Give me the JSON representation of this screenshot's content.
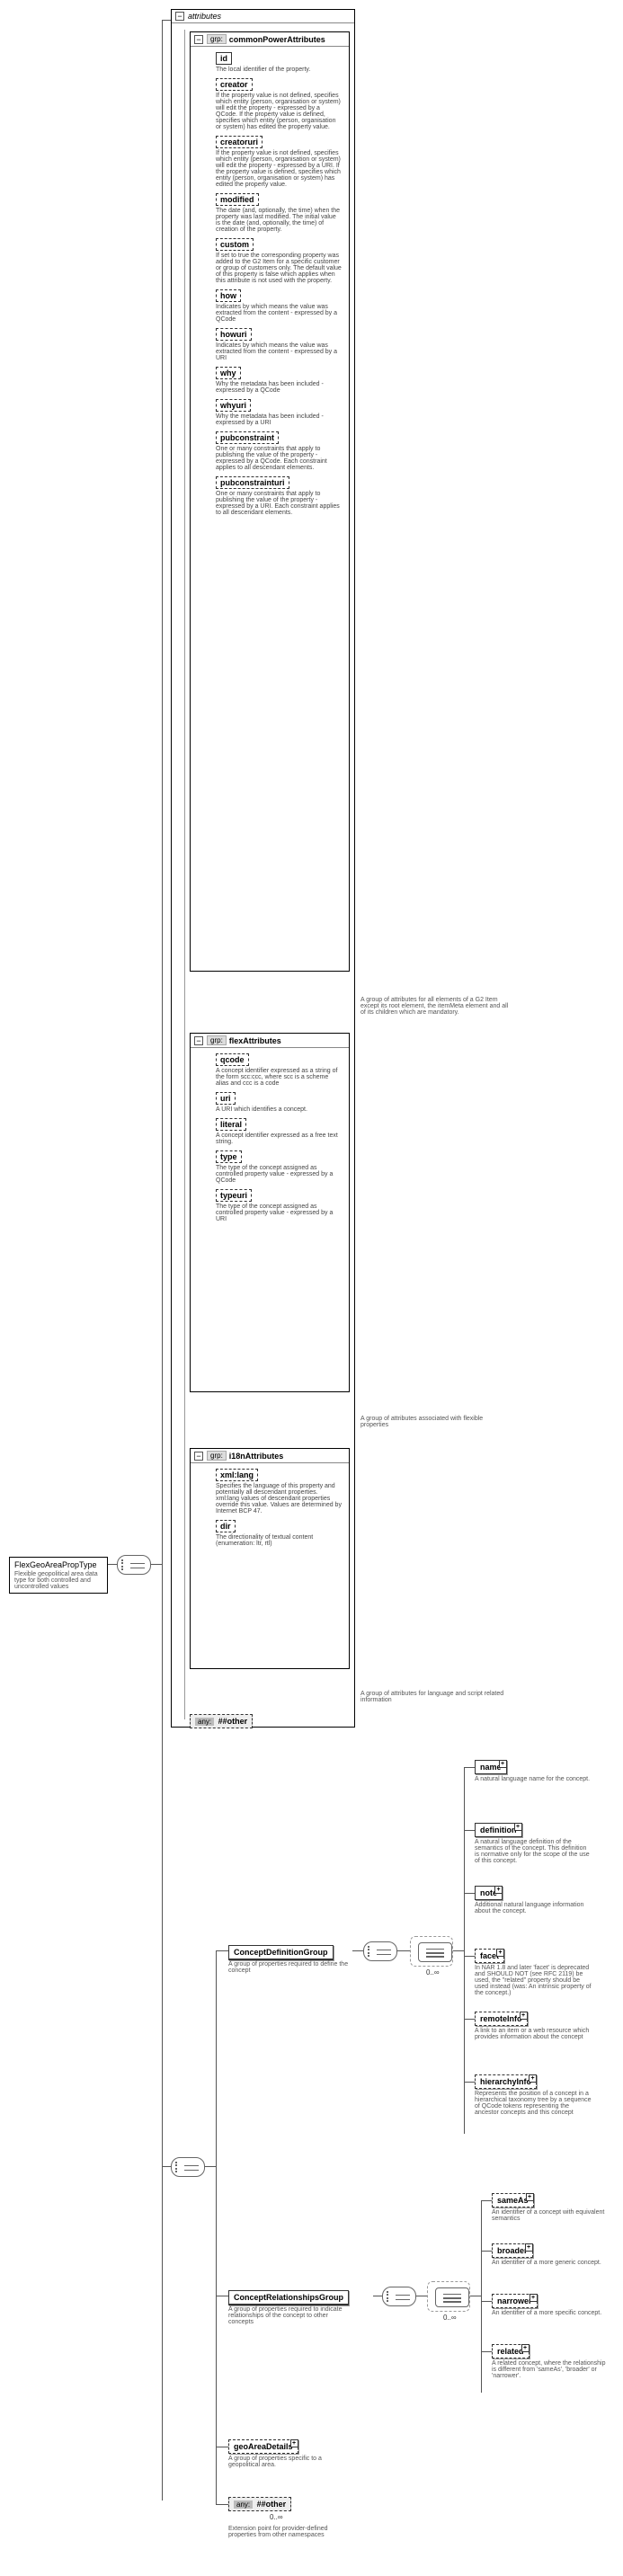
{
  "root": {
    "name": "FlexGeoAreaPropType",
    "desc": "Flexible geopolitical area data type for both controlled and uncontrolled values"
  },
  "attributes_box": {
    "label": "attributes",
    "collapse": "−"
  },
  "grp_cpa": {
    "label_prefix": "grp:",
    "label": "commonPowerAttributes",
    "collapse": "−",
    "footnote": "A group of attributes for all elements of a G2 Item except its root element, the itemMeta element and all of its children which are mandatory.",
    "items": [
      {
        "name": "id",
        "solid": true,
        "desc": "The local identifier of the property."
      },
      {
        "name": "creator",
        "desc": "If the property value is not defined, specifies which entity (person, organisation or system) will edit the property - expressed by a QCode. If the property value is defined, specifies which entity (person, organisation or system) has edited the property value."
      },
      {
        "name": "creatoruri",
        "desc": "If the property value is not defined, specifies which entity (person, organisation or system) will edit the property - expressed by a URI. If the property value is defined, specifies which entity (person, organisation or system) has edited the property value."
      },
      {
        "name": "modified",
        "desc": "The date (and, optionally, the time) when the property was last modified. The initial value is the date (and, optionally, the time) of creation of the property."
      },
      {
        "name": "custom",
        "desc": "If set to true the corresponding property was added to the G2 Item for a specific customer or group of customers only. The default value of this property is false which applies when this attribute is not used with the property."
      },
      {
        "name": "how",
        "desc": "Indicates by which means the value was extracted from the content - expressed by a QCode"
      },
      {
        "name": "howuri",
        "desc": "Indicates by which means the value was extracted from the content - expressed by a URI"
      },
      {
        "name": "why",
        "desc": "Why the metadata has been included - expressed by a QCode"
      },
      {
        "name": "whyuri",
        "desc": "Why the metadata has been included - expressed by a URI"
      },
      {
        "name": "pubconstraint",
        "desc": "One or many constraints that apply to publishing the value of the property - expressed by a QCode. Each constraint applies to all descendant elements."
      },
      {
        "name": "pubconstrainturi",
        "desc": "One or many constraints that apply to publishing the value of the property - expressed by a URI. Each constraint applies to all descendant elements."
      }
    ]
  },
  "grp_flex": {
    "label_prefix": "grp:",
    "label": "flexAttributes",
    "collapse": "−",
    "footnote": "A group of attributes associated with flexible properties",
    "items": [
      {
        "name": "qcode",
        "desc": "A concept identifier expressed as a string of the form scc:ccc, where scc is a scheme alias and ccc is a code"
      },
      {
        "name": "uri",
        "desc": "A URI which identifies a concept."
      },
      {
        "name": "literal",
        "desc": "A concept identifier expressed as a free text string."
      },
      {
        "name": "type",
        "desc": "The type of the concept assigned as controlled property value - expressed by a QCode"
      },
      {
        "name": "typeuri",
        "desc": "The type of the concept assigned as controlled property value - expressed by a URI"
      }
    ]
  },
  "grp_i18n": {
    "label_prefix": "grp:",
    "label": "i18nAttributes",
    "collapse": "−",
    "footnote": "A group of attributes for language and script related information",
    "items": [
      {
        "name": "xml:lang",
        "desc": "Specifies the language of this property and potentially all descendant properties. xml:lang values of descendant properties override this value. Values are determined by Internet BCP 47."
      },
      {
        "name": "dir",
        "desc": "The directionality of textual content (enumeration: ltr, rtl)"
      }
    ]
  },
  "any_attr": {
    "prefix": "any:",
    "label": "##other"
  },
  "concept_def_grp": {
    "name": "ConceptDefinitionGroup",
    "desc": "A group of properties required to define the concept",
    "occur": "0..∞",
    "children": [
      {
        "name": "name",
        "desc": "A natural language name for the concept."
      },
      {
        "name": "definition",
        "desc": "A natural language definition of the semantics of the concept. This definition is normative only for the scope of the use of this concept."
      },
      {
        "name": "note",
        "desc": "Additional natural language information about the concept."
      },
      {
        "name": "facet",
        "dashed": true,
        "desc": "In NAR 1.8 and later 'facet' is deprecated and SHOULD NOT (see RFC 2119) be used, the \"related\" property should be used instead (was: An intrinsic property of the concept.)"
      },
      {
        "name": "remoteInfo",
        "dashed": true,
        "desc": "A link to an item or a web resource which provides information about the concept"
      },
      {
        "name": "hierarchyInfo",
        "dashed": true,
        "desc": "Represents the position of a concept in a hierarchical taxonomy tree by a sequence of QCode tokens representing the ancestor concepts and this concept"
      }
    ]
  },
  "concept_rel_grp": {
    "name": "ConceptRelationshipsGroup",
    "desc": "A group of properties required to indicate relationships of the concept to other concepts",
    "occur": "0..∞",
    "children": [
      {
        "name": "sameAs",
        "dashed": true,
        "desc": "An identifier of a concept with equivalent semantics"
      },
      {
        "name": "broader",
        "dashed": true,
        "desc": "An identifier of a more generic concept."
      },
      {
        "name": "narrower",
        "dashed": true,
        "desc": "An identifier of a more specific concept."
      },
      {
        "name": "related",
        "dashed": true,
        "desc": "A related concept, where the relationship is different from 'sameAs', 'broader' or 'narrower'."
      }
    ]
  },
  "geo_area": {
    "name": "geoAreaDetails",
    "desc": "A group of properties specific to a geopolitical area."
  },
  "any_elem": {
    "prefix": "any:",
    "label": "##other",
    "occur": "0..∞",
    "desc": "Extension point for provider-defined properties from other namespaces"
  }
}
